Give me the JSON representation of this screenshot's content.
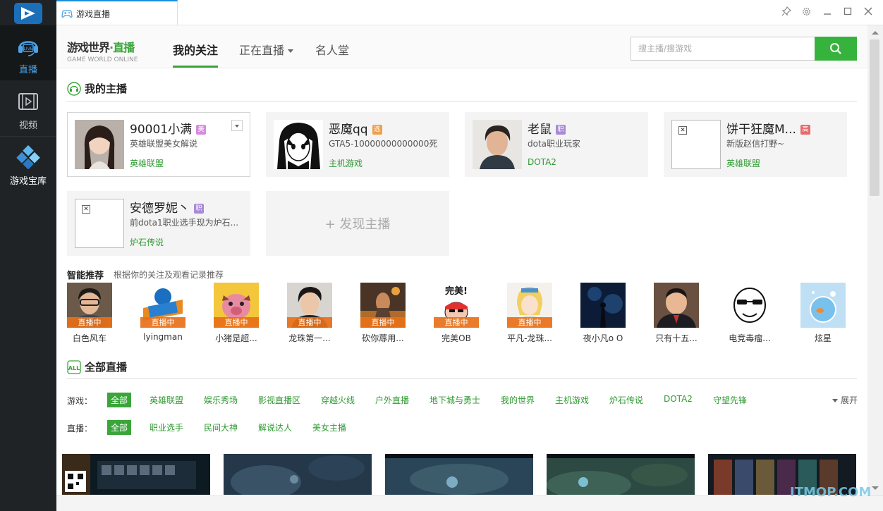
{
  "sidebar": {
    "items": [
      {
        "label": "直播",
        "icon": "live-headset-icon"
      },
      {
        "label": "视频",
        "icon": "film-icon"
      },
      {
        "label": "游戏宝库",
        "icon": "game-library-icon"
      }
    ],
    "live_icon_text": "LIVE"
  },
  "window": {
    "tab_title": "游戏直播",
    "controls": [
      "pin-icon",
      "gear-icon",
      "minimize-icon",
      "maximize-icon",
      "close-icon"
    ]
  },
  "header": {
    "brand_main": "游戏世界",
    "brand_accent": "·直播",
    "brand_sub": "GAME WORLD  ONLINE",
    "nav": [
      {
        "label": "我的关注"
      },
      {
        "label": "正在直播"
      },
      {
        "label": "名人堂"
      }
    ],
    "search_placeholder": "搜主播/搜游戏"
  },
  "my_anchors": {
    "title": "我的主播",
    "cards": [
      {
        "name": "90001小满",
        "badge": "美",
        "badge_color": "#d68be0",
        "desc": "英雄联盟美女解说",
        "game": "英雄联盟"
      },
      {
        "name": "恶魔qq",
        "badge": "选",
        "badge_color": "#f0a04b",
        "desc": "GTA5-10000000000000死",
        "game": "主机游戏"
      },
      {
        "name": "老鼠",
        "badge": "职",
        "badge_color": "#a98ad8",
        "desc": "dota职业玩家",
        "game": "DOTA2"
      },
      {
        "name": "饼干狂魔M...",
        "badge": "高",
        "badge_color": "#e86b6b",
        "desc": "新版赵信打野~",
        "game": "英雄联盟"
      },
      {
        "name": "安德罗妮丶",
        "badge": "职",
        "badge_color": "#a98ad8",
        "desc": "前dota1职业选手现为炉石...",
        "game": "炉石传说"
      }
    ],
    "discover_label": "+ 发现主播"
  },
  "recommend": {
    "title": "智能推荐",
    "subtitle": "根据你的关注及观看记录推荐",
    "live_label": "直播中",
    "items": [
      {
        "name": "白色风车",
        "live": true
      },
      {
        "name": "lyingman",
        "live": true
      },
      {
        "name": "小猪是超...",
        "live": true
      },
      {
        "name": "龙珠第一...",
        "live": true
      },
      {
        "name": "砍你蓐用...",
        "live": true
      },
      {
        "name": "完美OB",
        "live": true,
        "thumb_text": "完美!"
      },
      {
        "name": "平凡-龙珠...",
        "live": true
      },
      {
        "name": "夜小凡o O",
        "live": false
      },
      {
        "name": "只有十五...",
        "live": false
      },
      {
        "name": "电竞毒瘤...",
        "live": false
      },
      {
        "name": "炫星",
        "live": false
      }
    ]
  },
  "all_live": {
    "title": "全部直播",
    "all_icon_text": "ALL",
    "game_filter_label": "游戏：",
    "games": [
      "全部",
      "英雄联盟",
      "娱乐秀场",
      "影视直播区",
      "穿越火线",
      "户外直播",
      "地下城与勇士",
      "我的世界",
      "主机游戏",
      "炉石传说",
      "DOTA2",
      "守望先锋"
    ],
    "type_filter_label": "直播：",
    "types": [
      "全部",
      "职业选手",
      "民间大神",
      "解说达人",
      "美女主播"
    ],
    "expand_label": "展开"
  },
  "watermark": "ITMOP.COM",
  "colors": {
    "accent_green": "#3aa53a",
    "sidebar_bg": "#1f2326",
    "live_orange": "#e87018"
  }
}
